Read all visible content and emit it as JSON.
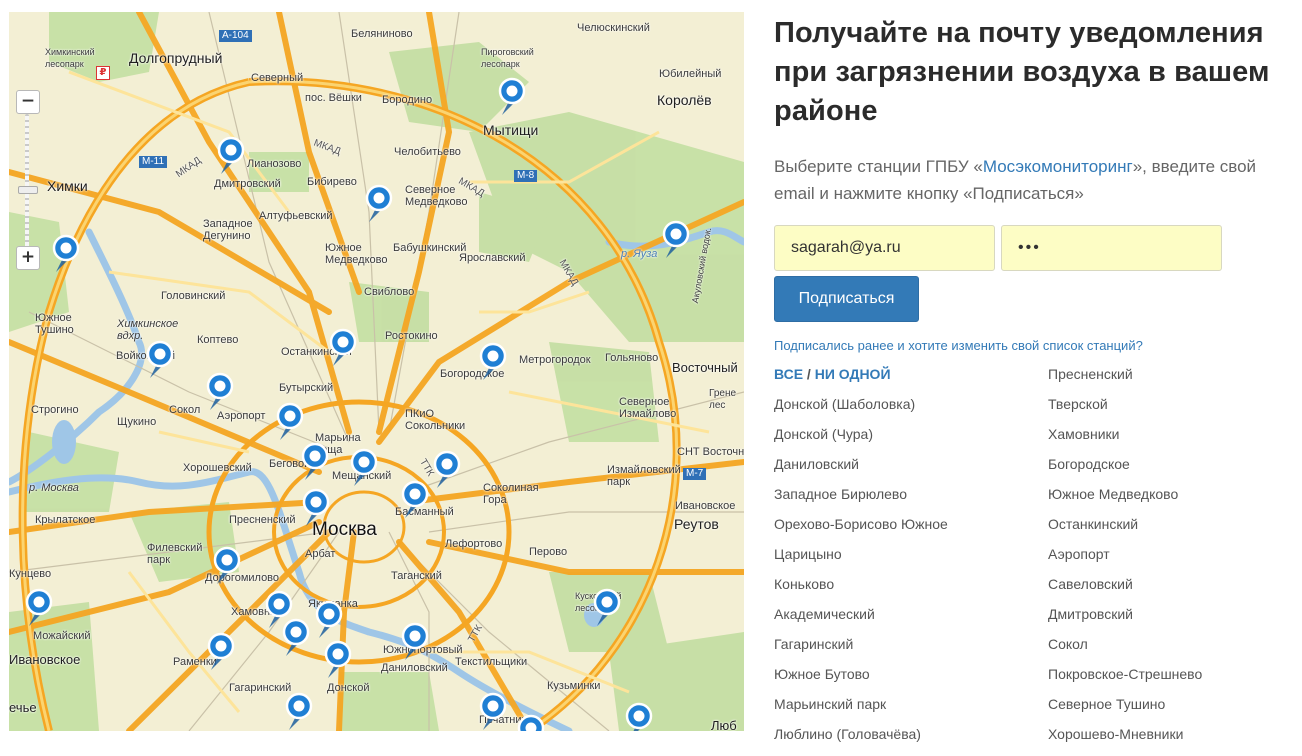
{
  "map": {
    "zoom_in_label": "+",
    "zoom_out_label": "−",
    "ruble_sign": "₽",
    "labels": {
      "dolgoprudny": "Долгопрудный",
      "khimki": "Химки",
      "khimkinsky_lesopark": "Химкинский\nлесопарк",
      "mytishchi": "Мытищи",
      "korolev": "Королёв",
      "yubileyny": "Юбилейный",
      "chelyuskinsky": "Челюскинский",
      "belyaninovo": "Беляниново",
      "pirogovsky_lesopark": "Пироговский\nлесопарк",
      "moskva": "Москва",
      "reutov": "Реутов",
      "vostochny": "Восточный",
      "severny": "Северный",
      "pos_vyoshki": "пос. Вёшки",
      "borodino": "Бородино",
      "chelobitevo": "Челобитьево",
      "dianozovo": "Лианозово",
      "dmitrovsky": "Дмитровский",
      "bibirevo": "Бибирево",
      "altufevsky": "Алтуфьевский",
      "zapadnoe_degunino": "Западное\nДегунино",
      "severnoe_medvedkovo": "Северное\nМедведково",
      "yuzhnoe_medvedkovo": "Южное\nМедведково",
      "babushkinsky": "Бабушкинский",
      "yaroslavsky": "Ярославский",
      "sviblovo": "Свиблово",
      "golovinsky": "Головинский",
      "yuzhnoe_tushino": "Южное\nТушино",
      "khimkinskoe_vdkhr": "Химкинское\nвдхр.",
      "koptevo": "Коптево",
      "ostankinsky": "Останкинский",
      "rostokino": "Ростокино",
      "metrogorodok": "Метрогородок",
      "golyanovo": "Гольяново",
      "bogorodskoe": "Богородское",
      "voykovsky": "Войковский",
      "sokol": "Сокол",
      "aeroport": "Аэропорт",
      "butyrsky": "Бутырский",
      "pkio_sokolniki": "ПКиО\nСокольники",
      "strogino": "Строгино",
      "shchukino": "Щукино",
      "severnoe_izmaylovo": "Северное\nИзмайлово",
      "marina_roshcha": "Марьина\nроща",
      "beg": "Беговой",
      "meshch": "Мещанский",
      "khoroshevsky": "Хорошевский",
      "izmaylovsky_park": "Измайловский\nпарк",
      "snt_vostochny": "СНТ Восточный",
      "r_moskva": "р. Москва",
      "sokolnaya_gora": "Соколиная\nГора",
      "basmanny": "Басманный",
      "krylatskoe": "Крылатское",
      "presnensky": "Пресненский",
      "ivanovskoe": "Ивановское",
      "filevsky_park": "Филевский\nпарк",
      "lefortovo": "Лефортово",
      "perovo": "Перово",
      "arbat": "Арбат",
      "dorogomilovo": "Дорогомилово",
      "kuntsevo": "Кунцево",
      "taganskiy": "Таганский",
      "khamovniki": "Хамовники",
      "yakimanka": "Якиманка",
      "mozhaysky": "Можайский",
      "kuskovsky_lesopark": "Кусковский\nлесопарк",
      "ivanovskoe_w": "Ивановское",
      "ramenki": "Раменки",
      "yuzhnoportovy": "Южнопортовый",
      "danilovsky": "Даниловский",
      "tekstilshchiki": "Текстильщики",
      "gagarinsky": "Гагаринский",
      "kuzminki": "Кузьминки",
      "donskoy": "Донской",
      "ochakovo": "ечье",
      "pechatniki": "Печатники",
      "lyub": "Люб",
      "r_yauza": "р. Яуза",
      "akulovsky_vodok": "Акуловский водок.",
      "mkad1": "МКАД",
      "mkad2": "МКАД",
      "mkad3": "МКАД",
      "mkad4": "МКАД",
      "ttk": "ТТК",
      "ttk2": "ТТК",
      "m11": "M-11",
      "m8": "M-8",
      "m7": "M-7",
      "a104": "A-104",
      "greben": "Грене\nлес"
    }
  },
  "panel": {
    "title": "Получайте на почту уведомления при загрязнении воздуха в вашем районе",
    "lead_before": "Выберите станции ГПБУ «",
    "lead_link": "Мосэкомониторинг",
    "lead_after": "», введите свой email и нажмите кнопку «Подписаться»",
    "email_value": "sagarah@ya.ru",
    "password_value": "•••",
    "subscribe_label": "Подписаться",
    "change_link": "Подписались ранее и хотите изменить свой список станций?",
    "all_label": "ВСЕ",
    "separator": " / ",
    "none_label": "НИ ОДНОЙ",
    "stations_left": [
      "Донской (Шаболовка)",
      "Донской (Чура)",
      "Даниловский",
      "Западное Бирюлево",
      "Орехово-Борисово Южное",
      "Царицыно",
      "Коньково",
      "Академический",
      "Гагаринский",
      "Южное Бутово",
      "Марьинский парк",
      "Люблино (Головачёва)"
    ],
    "stations_right": [
      "Пресненский",
      "Тверской",
      "Хамовники",
      "Богородское",
      "Южное Медведково",
      "Останкинский",
      "Аэропорт",
      "Савеловский",
      "Дмитровский",
      "Сокол",
      "Покровское-Стрешнево",
      "Северное Тушино",
      "Хорошево-Мневники"
    ]
  }
}
